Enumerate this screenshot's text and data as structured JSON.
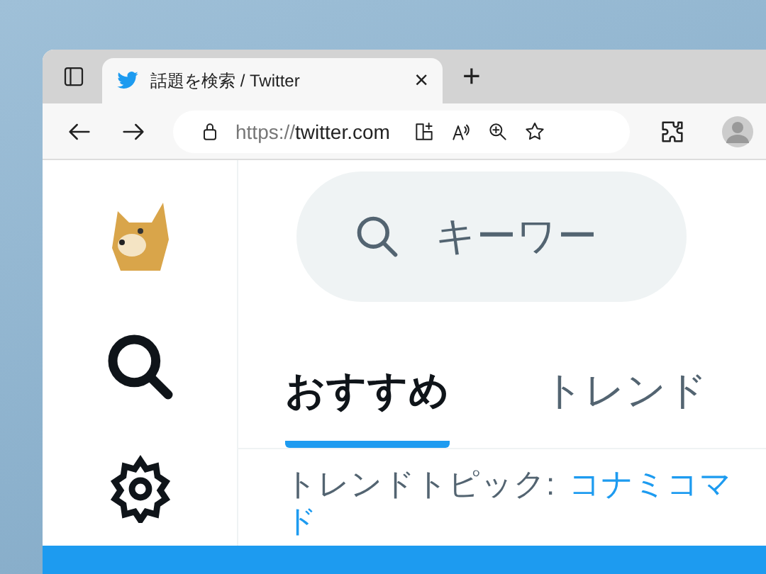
{
  "browser": {
    "tab": {
      "title": "話題を検索 / Twitter",
      "close": "×"
    },
    "new_tab": "+",
    "address": {
      "scheme": "https://",
      "host": "twitter.com"
    }
  },
  "search": {
    "placeholder": "キーワー"
  },
  "tabs": [
    {
      "label": "おすすめ",
      "selected": true
    },
    {
      "label": "トレンド",
      "selected": false
    }
  ],
  "trend": {
    "label": "トレンドトピック:",
    "link_lines": [
      "コナミコマ",
      "ド"
    ]
  }
}
